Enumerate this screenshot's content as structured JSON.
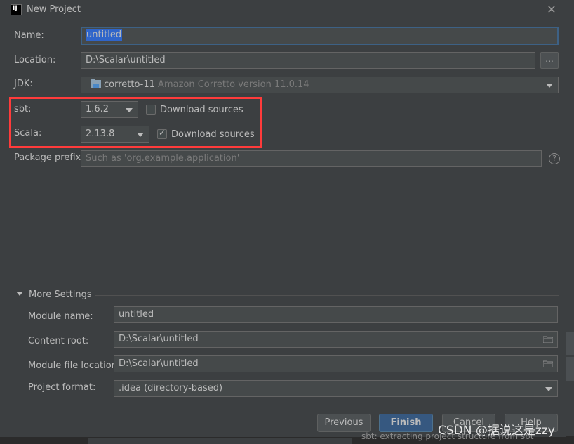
{
  "window": {
    "title": "New Project",
    "app_icon_text": "IJ"
  },
  "form": {
    "name": {
      "label": "Name:",
      "value": "untitled"
    },
    "location": {
      "label": "Location:",
      "value": "D:\\Scalar\\untitled",
      "browse_label": "..."
    },
    "jdk": {
      "label": "JDK:",
      "value": "corretto-11",
      "detail": "Amazon Corretto version 11.0.14"
    },
    "sbt": {
      "label": "sbt:",
      "value": "1.6.2",
      "download_label": "Download sources",
      "download_checked": false
    },
    "scala": {
      "label": "Scala:",
      "value": "2.13.8",
      "download_label": "Download sources",
      "download_checked": true
    },
    "package_prefix": {
      "label": "Package prefix:",
      "placeholder": "Such as 'org.example.application'",
      "help": "?"
    }
  },
  "more_settings": {
    "header": "More Settings",
    "module_name": {
      "label": "Module name:",
      "value": "untitled"
    },
    "content_root": {
      "label": "Content root:",
      "value": "D:\\Scalar\\untitled"
    },
    "module_file_location": {
      "label": "Module file location:",
      "value": "D:\\Scalar\\untitled"
    },
    "project_format": {
      "label": "Project format:",
      "value": ".idea (directory-based)"
    }
  },
  "buttons": {
    "previous": "Previous",
    "finish": "Finish",
    "cancel": "Cancel",
    "help": "Help"
  },
  "background": {
    "status_text": "sbt: extracting project structure from sbt"
  },
  "watermark": "CSDN @据说这是zzy",
  "colors": {
    "highlight_box": "#ff3b3b",
    "default_button": "#365880",
    "selection": "#2f65ca"
  }
}
